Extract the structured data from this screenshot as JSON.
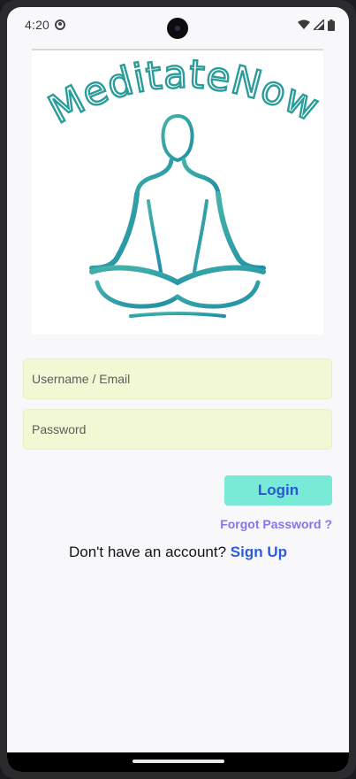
{
  "status_bar": {
    "time": "4:20",
    "icons": [
      "app-notification-icon",
      "wifi-icon",
      "cellular-icon",
      "battery-icon"
    ]
  },
  "logo": {
    "text": "MeditateNow",
    "color": "#2a9d9a"
  },
  "form": {
    "username_placeholder": "Username / Email",
    "username_value": "",
    "password_placeholder": "Password",
    "password_value": ""
  },
  "actions": {
    "login_label": "Login",
    "forgot_password_label": "Forgot Password ?",
    "no_account_text": "Don't have an account?",
    "sign_up_label": "Sign Up"
  },
  "colors": {
    "field_background": "#f2f8d4",
    "login_background": "#79ead6",
    "login_text": "#2a55d6",
    "forgot_text": "#8874ea",
    "signup_text": "#2f5be0"
  }
}
